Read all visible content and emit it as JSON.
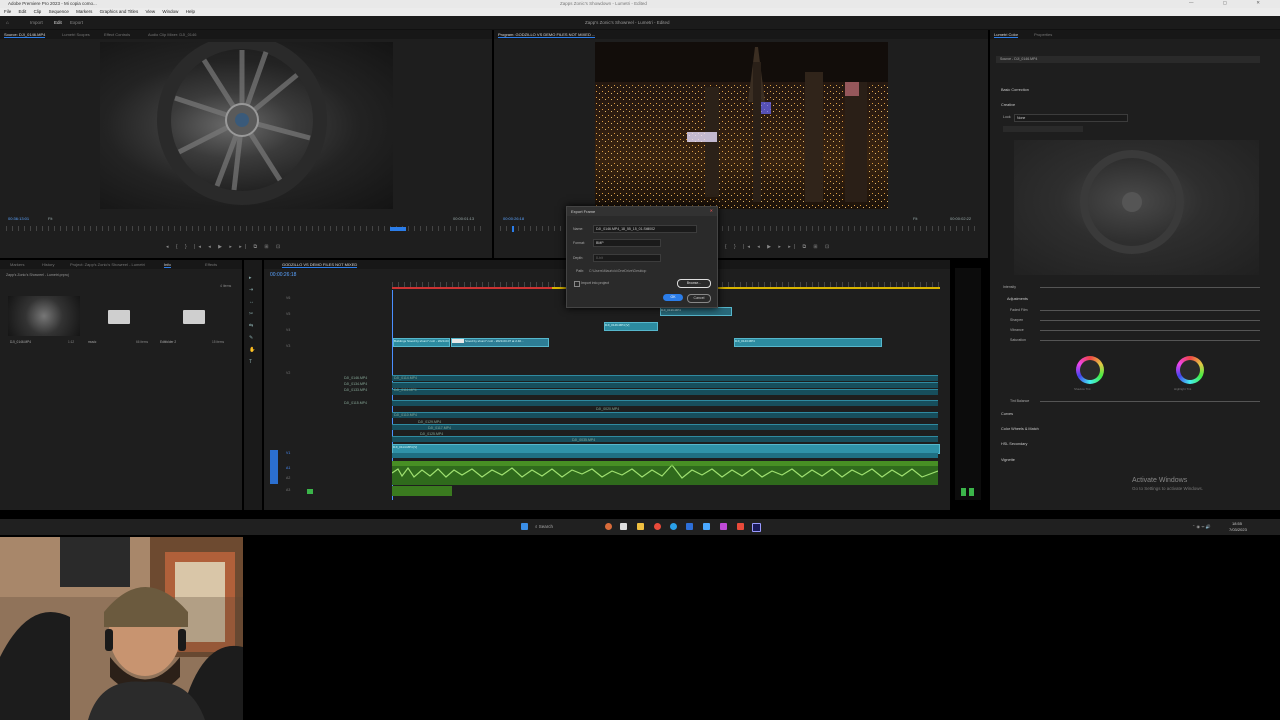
{
  "titlebar": {
    "title": "Adobe Premiere Pro 2023 - Mi copia como...",
    "center": "Zapps Zonic's Showdown - Lumetri - Edited"
  },
  "menubar": {
    "items": [
      "File",
      "Edit",
      "Clip",
      "Sequence",
      "Markers",
      "Graphics and Titles",
      "View",
      "Window",
      "Help"
    ]
  },
  "header": {
    "workspaces": [
      "Import",
      "Edit",
      "Export"
    ],
    "center_title": "Zapp's Zonic's Showreel - Lumetri - Edited"
  },
  "source_monitor": {
    "tabs": [
      "Source: DJI_0146.MP4",
      "Lumetri Scopes",
      "Effect Controls",
      "Audio Clip Mixer: DJI_0146"
    ],
    "timecode_left": "00:36:13:01",
    "timecode_right": "00:00:01:13",
    "fit": "Fit"
  },
  "program_monitor": {
    "tab": "Program: GODZILLO VS DEMO FILES NOT MIXED ...",
    "timecode_left": "00:00:26:18",
    "timecode_right": "00:00:02:22",
    "fit": "Fit"
  },
  "project_panel": {
    "tabs": [
      "Markers",
      "History",
      "Project: Zapp's Zonic's Showreel - Lumetri",
      "Info",
      "Effects"
    ],
    "path": "Zapp's Zonic's Showreel - Lumetri.prproj",
    "items_count": "4 items",
    "items": [
      {
        "name": "DJI_0146.MP4",
        "meta": "1:12"
      },
      {
        "name": "music",
        "meta": "66 items"
      },
      {
        "name": "Editfolder 2",
        "meta": "15 items"
      }
    ]
  },
  "timeline": {
    "tab": "GODZILLO VS DEMO FILES NOT MIXED",
    "timecode": "00:00:26:18",
    "video_clips": [
      "Buildings Stood by shum7 cutz - 2023-03-07 at 2.40...",
      "DJI_0146.MP4 [V]",
      "DJI_0136.MP4",
      "DJI_0143.MP4",
      "DJI_0114.MP4 [V]"
    ],
    "track_labels": [
      "DJI_0146.MP4",
      "DJI_0134.MP4",
      "DJI_0133.MP4",
      "DJI_0115.MP4",
      "DJI_0114.MP4",
      "DJI_0111.MP4",
      "DJI_0110.MP4",
      "DJI_0129.MP4",
      "DJI_0117.MP4",
      "DJI_0125.MP4",
      "DJI_0020.MP4",
      "DJI_0035.MP4"
    ],
    "track_names": [
      "V6",
      "V5",
      "V4",
      "V3",
      "V2",
      "V1",
      "A1",
      "A2",
      "A3"
    ]
  },
  "export_frame_dialog": {
    "title": "Export Frame",
    "name_label": "Name:",
    "name_value": "DJI_0146.MP4_18_55_15_01.Still002",
    "format_label": "Format:",
    "format_value": "BMP",
    "depth_label": "Depth:",
    "depth_value": "8-bit",
    "path_label": "Path:",
    "path_value": "C:\\Users\\Mauricio\\OneDrive\\Desktop",
    "import_label": "Import into project",
    "browse_label": "Browse...",
    "ok_label": "OK",
    "cancel_label": "Cancel"
  },
  "lumetri": {
    "tabs": [
      "Lumetri Color",
      "Properties"
    ],
    "clip": "Source - DJI_0146.MP4",
    "sections": [
      "Basic Correction",
      "Creative",
      "Curves",
      "Color Wheels & Match",
      "HSL Secondary",
      "Vignette"
    ],
    "look_label": "Look",
    "look_value": "None",
    "intensity_label": "Intensity",
    "adjustments_label": "Adjustments",
    "adjust_items": [
      "Faded Film",
      "Sharpen",
      "Vibrance",
      "Saturation"
    ],
    "shadow_tint": "Shadow Tint",
    "highlight_tint": "Highlight Tint",
    "tint_balance": "Tint Balance",
    "activate_title": "Activate Windows",
    "activate_sub": "Go to Settings to activate Windows."
  },
  "taskbar": {
    "search": "Search",
    "time": "18:55",
    "date": "7/03/2023"
  },
  "colors": {
    "accent": "#2b7de9",
    "clip_video": "#2c8ba0",
    "audio_green": "#58a82a"
  }
}
